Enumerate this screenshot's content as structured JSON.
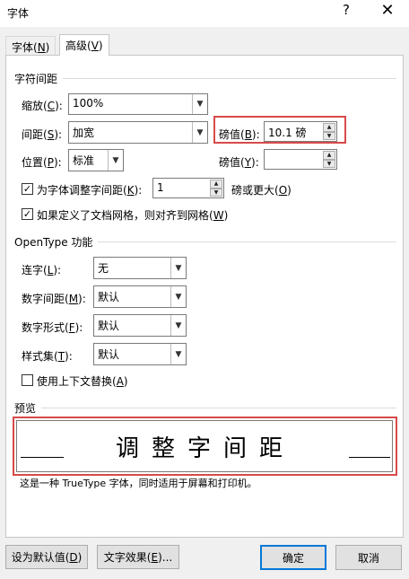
{
  "window": {
    "title": "字体",
    "help": "?",
    "close": "✕"
  },
  "tabs": [
    {
      "label": "字体(",
      "key": "N",
      "end": ")"
    },
    {
      "label": "高级(",
      "key": "V",
      "end": ")"
    }
  ],
  "spacing": {
    "section": "字符间距",
    "scale": {
      "label": "缩放(",
      "key": "C",
      "end": "):",
      "value": "100%"
    },
    "spacing": {
      "label": "间距(",
      "key": "S",
      "end": "):",
      "value": "加宽"
    },
    "spacing_by": {
      "label": "磅值(",
      "key": "B",
      "end": "):",
      "value": "10.1 磅"
    },
    "position": {
      "label": "位置(",
      "key": "P",
      "end": "):",
      "value": "标准"
    },
    "position_by": {
      "label": "磅值(",
      "key": "Y",
      "end": "):",
      "value": ""
    },
    "kerning": {
      "label": "为字体调整字间距(",
      "key": "K",
      "end": "):",
      "value": "1",
      "suffix": "磅或更大(",
      "suffix_key": "O",
      "suffix_end": ")",
      "checked": true
    },
    "grid": {
      "label": "如果定义了文档网格，则对齐到网格(",
      "key": "W",
      "end": ")",
      "checked": true
    }
  },
  "opentype": {
    "section": "OpenType 功能",
    "ligatures": {
      "label": "连字(",
      "key": "L",
      "end": "):",
      "value": "无"
    },
    "num_spacing": {
      "label": "数字间距(",
      "key": "M",
      "end": "):",
      "value": "默认"
    },
    "num_forms": {
      "label": "数字形式(",
      "key": "F",
      "end": "):",
      "value": "默认"
    },
    "stylistic": {
      "label": "样式集(",
      "key": "T",
      "end": "):",
      "value": "默认"
    },
    "contextual": {
      "label": "使用上下文替换(",
      "key": "A",
      "end": ")",
      "checked": false
    }
  },
  "preview": {
    "section": "预览",
    "text": "调整字间距",
    "note": "这是一种 TrueType 字体，同时适用于屏幕和打印机。"
  },
  "buttons": {
    "default": {
      "label": "设为默认值(",
      "key": "D",
      "end": ")"
    },
    "effects": {
      "label": "文字效果(",
      "key": "E",
      "end": ")..."
    },
    "ok": "确定",
    "cancel": "取消"
  },
  "colors": {
    "highlight": "#d84a4a",
    "accent": "#0078d7"
  }
}
